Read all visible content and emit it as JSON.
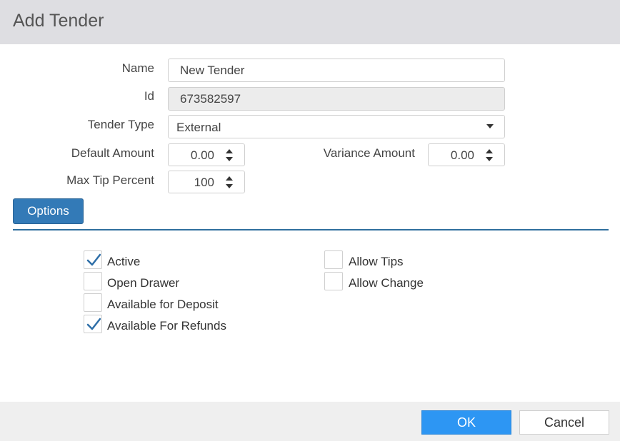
{
  "dialog": {
    "title": "Add Tender"
  },
  "form": {
    "name": {
      "label": "Name",
      "value": "New Tender"
    },
    "id": {
      "label": "Id",
      "value": "673582597"
    },
    "tender_type": {
      "label": "Tender Type",
      "value": "External"
    },
    "default_amount": {
      "label": "Default Amount",
      "value": "0.00"
    },
    "variance_amount": {
      "label": "Variance Amount",
      "value": "0.00"
    },
    "max_tip_percent": {
      "label": "Max Tip Percent",
      "value": "100"
    }
  },
  "options_tab": {
    "label": "Options"
  },
  "checkboxes": {
    "active": {
      "label": "Active",
      "checked": true
    },
    "open_drawer": {
      "label": "Open Drawer",
      "checked": false
    },
    "available_for_deposit": {
      "label": "Available for Deposit",
      "checked": false
    },
    "available_for_refunds": {
      "label": "Available For Refunds",
      "checked": true
    },
    "allow_tips": {
      "label": "Allow Tips",
      "checked": false
    },
    "allow_change": {
      "label": "Allow Change",
      "checked": false
    }
  },
  "footer": {
    "ok_label": "OK",
    "cancel_label": "Cancel"
  },
  "colors": {
    "accent": "#337ab7",
    "ok": "#2d96f3",
    "check": "#2f6fa8"
  }
}
